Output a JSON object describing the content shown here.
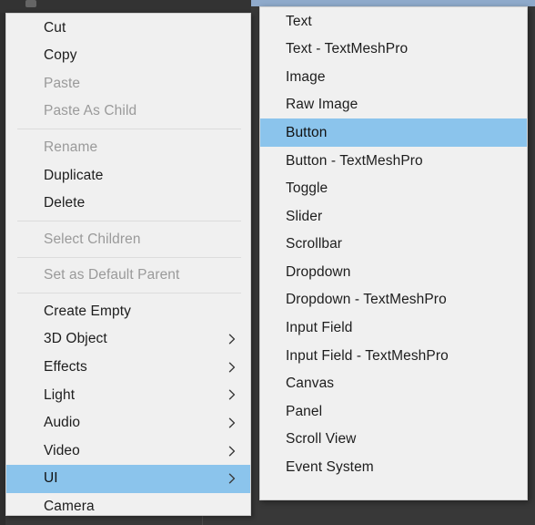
{
  "theme": {
    "menu_background": "#f0f0f0",
    "menu_border": "#cfcfcf",
    "highlight": "#8bc4ec",
    "text": "#1d1d1d",
    "text_disabled": "#9a9a9a",
    "separator": "#dcdcdc",
    "editor_background": "#383838",
    "titlebar_blue": "#8faacb"
  },
  "context_menu": {
    "name": "hierarchy-context-menu",
    "groups": [
      {
        "items": [
          {
            "label": "Cut",
            "disabled": false,
            "has_submenu": false,
            "highlighted": false
          },
          {
            "label": "Copy",
            "disabled": false,
            "has_submenu": false,
            "highlighted": false
          },
          {
            "label": "Paste",
            "disabled": true,
            "has_submenu": false,
            "highlighted": false
          },
          {
            "label": "Paste As Child",
            "disabled": true,
            "has_submenu": false,
            "highlighted": false
          }
        ]
      },
      {
        "items": [
          {
            "label": "Rename",
            "disabled": true,
            "has_submenu": false,
            "highlighted": false
          },
          {
            "label": "Duplicate",
            "disabled": false,
            "has_submenu": false,
            "highlighted": false
          },
          {
            "label": "Delete",
            "disabled": false,
            "has_submenu": false,
            "highlighted": false
          }
        ]
      },
      {
        "items": [
          {
            "label": "Select Children",
            "disabled": true,
            "has_submenu": false,
            "highlighted": false
          }
        ]
      },
      {
        "items": [
          {
            "label": "Set as Default Parent",
            "disabled": true,
            "has_submenu": false,
            "highlighted": false
          }
        ]
      },
      {
        "items": [
          {
            "label": "Create Empty",
            "disabled": false,
            "has_submenu": false,
            "highlighted": false
          },
          {
            "label": "3D Object",
            "disabled": false,
            "has_submenu": true,
            "highlighted": false
          },
          {
            "label": "Effects",
            "disabled": false,
            "has_submenu": true,
            "highlighted": false
          },
          {
            "label": "Light",
            "disabled": false,
            "has_submenu": true,
            "highlighted": false
          },
          {
            "label": "Audio",
            "disabled": false,
            "has_submenu": true,
            "highlighted": false
          },
          {
            "label": "Video",
            "disabled": false,
            "has_submenu": true,
            "highlighted": false
          },
          {
            "label": "UI",
            "disabled": false,
            "has_submenu": true,
            "highlighted": true
          },
          {
            "label": "Camera",
            "disabled": false,
            "has_submenu": false,
            "highlighted": false
          }
        ]
      }
    ]
  },
  "submenu": {
    "name": "ui-submenu",
    "parent_item": "UI",
    "items": [
      {
        "label": "Text",
        "highlighted": false
      },
      {
        "label": "Text - TextMeshPro",
        "highlighted": false
      },
      {
        "label": "Image",
        "highlighted": false
      },
      {
        "label": "Raw Image",
        "highlighted": false
      },
      {
        "label": "Button",
        "highlighted": true
      },
      {
        "label": "Button - TextMeshPro",
        "highlighted": false
      },
      {
        "label": "Toggle",
        "highlighted": false
      },
      {
        "label": "Slider",
        "highlighted": false
      },
      {
        "label": "Scrollbar",
        "highlighted": false
      },
      {
        "label": "Dropdown",
        "highlighted": false
      },
      {
        "label": "Dropdown - TextMeshPro",
        "highlighted": false
      },
      {
        "label": "Input Field",
        "highlighted": false
      },
      {
        "label": "Input Field - TextMeshPro",
        "highlighted": false
      },
      {
        "label": "Canvas",
        "highlighted": false
      },
      {
        "label": "Panel",
        "highlighted": false
      },
      {
        "label": "Scroll View",
        "highlighted": false
      },
      {
        "label": "Event System",
        "highlighted": false
      }
    ]
  }
}
